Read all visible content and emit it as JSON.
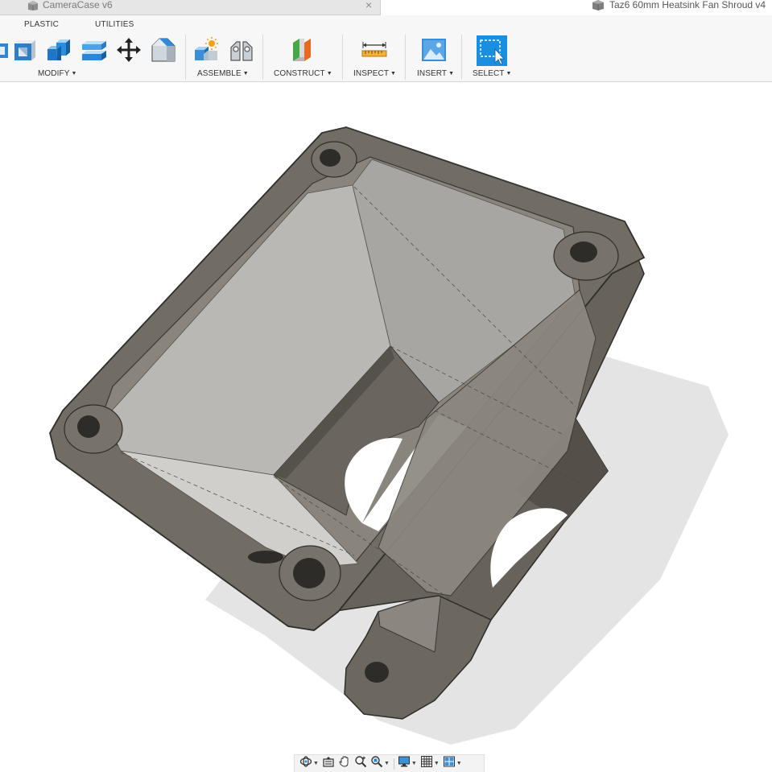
{
  "document_tab": {
    "title": "CameraCase v6",
    "close_glyph": "×"
  },
  "other_document": {
    "title": "Taz6 60mm Heatsink Fan Shroud v4"
  },
  "workspace_tabs": {
    "plastic": "PLASTIC",
    "utilities": "UTILITIES"
  },
  "groups": {
    "modify": "MODIFY",
    "assemble": "ASSEMBLE",
    "construct": "CONSTRUCT",
    "inspect": "INSPECT",
    "insert": "INSERT",
    "select": "SELECT"
  },
  "icons": {
    "tab_cube": "cube-icon",
    "shell": "shell-icon",
    "combine": "combine-icon",
    "offset_face": "offset-face-icon",
    "move": "move-icon",
    "chamfer": "chamfer-icon",
    "new_component": "new-component-icon",
    "joint": "joint-icon",
    "construct_plane": "offset-plane-icon",
    "measure": "measure-icon",
    "insert_image": "insert-image-icon",
    "select": "select-icon",
    "orbit": "orbit-icon",
    "look_at": "look-at-icon",
    "pan": "pan-icon",
    "zoom": "zoom-icon",
    "fit": "zoom-window-icon",
    "display": "display-settings-icon",
    "grid": "grid-icon",
    "viewports": "viewports-icon"
  },
  "colors": {
    "ribbon_bg": "#f7f7f7",
    "accent_blue": "#1f8ad8",
    "body_dark": "#6f6a61",
    "body_edge": "#3e3b37",
    "inner_light": "#c9c9c6",
    "shadow": "#e6e6e6"
  }
}
